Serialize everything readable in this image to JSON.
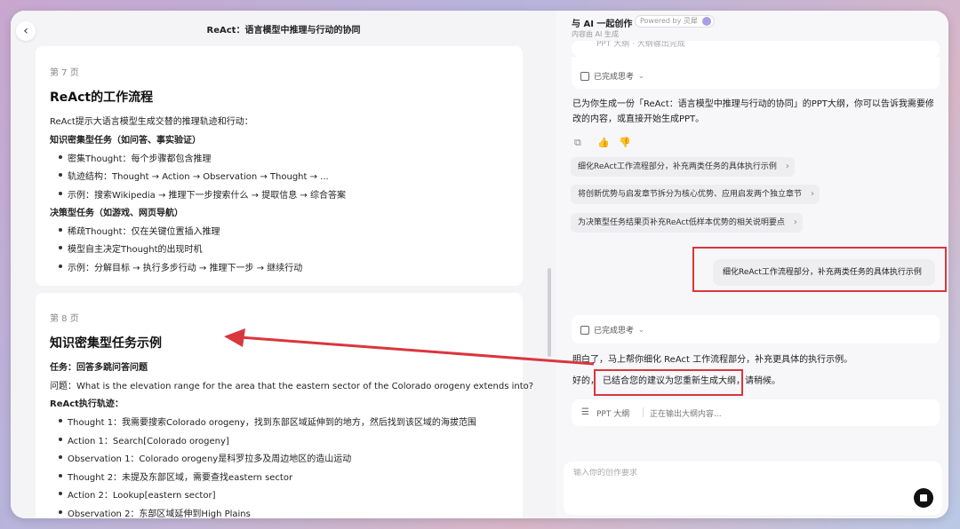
{
  "document": {
    "title": "ReAct：语言模型中推理与行动的协同",
    "pages": [
      {
        "page_label": "第 7 页",
        "heading": "ReAct的工作流程",
        "intro": "ReAct提示大语言模型生成交替的推理轨迹和行动：",
        "sections": [
          {
            "title": "知识密集型任务（如问答、事实验证）",
            "bullets": [
              "密集Thought：每个步骤都包含推理",
              "轨迹结构：Thought → Action → Observation → Thought → ...",
              "示例：搜索Wikipedia → 推理下一步搜索什么 → 提取信息 → 综合答案"
            ]
          },
          {
            "title": "决策型任务（如游戏、网页导航）",
            "bullets": [
              "稀疏Thought：仅在关键位置插入推理",
              "模型自主决定Thought的出现时机",
              "示例：分解目标 → 执行多步行动 → 推理下一步 → 继续行动"
            ]
          }
        ]
      },
      {
        "page_label": "第 8 页",
        "heading": "知识密集型任务示例",
        "task": "任务：回答多跳问答问题",
        "question": "问题：What is the elevation range for the area that the eastern sector of the Colorado orogeny extends into?",
        "trace_title": "ReAct执行轨迹：",
        "trace": [
          "Thought 1：我需要搜索Colorado orogeny，找到东部区域延伸到的地方，然后找到该区域的海拔范围",
          "Action 1：Search[Colorado orogeny]",
          "Observation 1：Colorado orogeny是科罗拉多及周边地区的造山运动",
          "Thought 2：未提及东部区域，需要查找eastern sector",
          "Action 2：Lookup[eastern sector]",
          "Observation 2：东部区域延伸到High Plains"
        ]
      }
    ]
  },
  "assistant": {
    "header_title": "与 AI 一起创作",
    "powered_by": "Powered by 灵犀",
    "subtitle": "内容由 AI 生成",
    "prev_outline_text": "PPT 大纲 · 大纲输出完成",
    "thought_done_label": "已完成思考",
    "reply_1": "已为你生成一份「ReAct：语言模型中推理与行动的协同」的PPT大纲，你可以告诉我需要修改的内容，或直接开始生成PPT。",
    "suggestions": [
      "细化ReAct工作流程部分，补充两类任务的具体执行示例",
      "将创新优势与启发章节拆分为核心优势、应用启发两个独立章节",
      "为决策型任务结果页补充ReAct低样本优势的相关说明要点"
    ],
    "user_message": "细化ReAct工作流程部分，补充两类任务的具体执行示例",
    "thought_done_label_2": "已完成思考",
    "reply_2_line1": "明白了，马上帮你细化 ReAct 工作流程部分，补充更具体的执行示例。",
    "reply_2_prefix": "好的，",
    "reply_2_highlight": "已结合您的建议为您重新生成大纲，",
    "reply_2_suffix": "请稍候。",
    "outline_label": "PPT 大纲",
    "outline_status": "正在输出大纲内容...",
    "input_placeholder": "输入你的创作要求"
  },
  "colors": {
    "annotation_red": "#d9363e",
    "window_bg": "#ffffff",
    "pane_bg": "#f4f4f6"
  },
  "icons": [
    "back-arrow-icon",
    "thought-icon",
    "chevron-down-icon",
    "copy-icon",
    "thumbs-up-icon",
    "thumbs-down-icon",
    "chevron-right-icon",
    "list-icon",
    "stop-icon"
  ]
}
